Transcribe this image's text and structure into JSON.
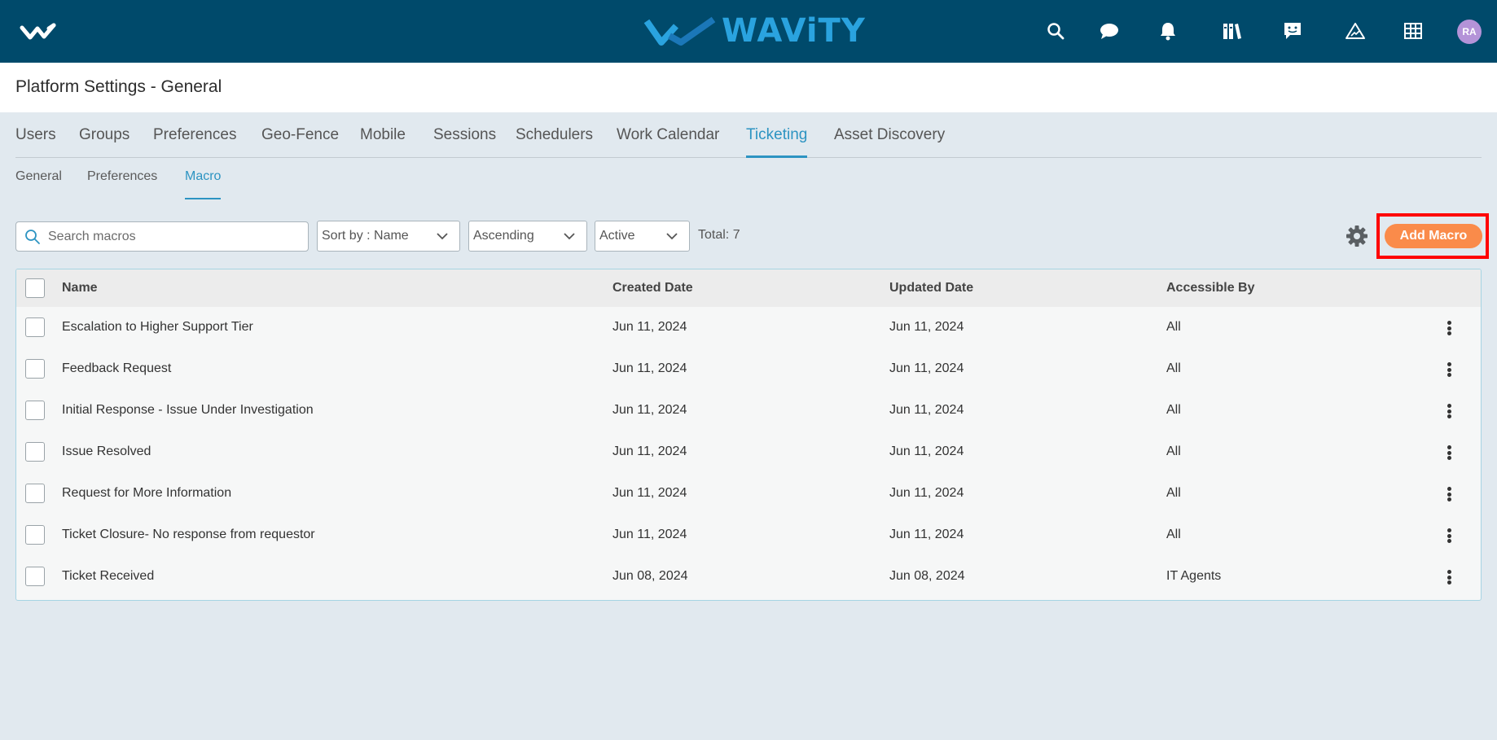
{
  "header": {
    "brand": "WAViTY",
    "avatar_initials": "RA",
    "icons": [
      "search-icon",
      "chat-icon",
      "bell-icon",
      "books-icon",
      "feedback-icon",
      "alert-icon",
      "grid-icon"
    ]
  },
  "page": {
    "title": "Platform Settings - General"
  },
  "tabs": [
    {
      "label": "Users"
    },
    {
      "label": "Groups"
    },
    {
      "label": "Preferences"
    },
    {
      "label": "Geo-Fence"
    },
    {
      "label": "Mobile"
    },
    {
      "label": "Sessions"
    },
    {
      "label": "Schedulers"
    },
    {
      "label": "Work Calendar"
    },
    {
      "label": "Ticketing"
    },
    {
      "label": "Asset Discovery"
    }
  ],
  "active_tab": "Ticketing",
  "subtabs": [
    {
      "label": "General"
    },
    {
      "label": "Preferences"
    },
    {
      "label": "Macro"
    }
  ],
  "active_subtab": "Macro",
  "toolbar": {
    "search_placeholder": "Search macros",
    "sort_by": "Sort by : Name",
    "order": "Ascending",
    "status": "Active",
    "total": "Total: 7",
    "add_label": "Add Macro"
  },
  "table": {
    "headers": {
      "name": "Name",
      "created": "Created Date",
      "updated": "Updated Date",
      "access": "Accessible By"
    },
    "rows": [
      {
        "name": "Escalation to Higher Support Tier",
        "created": "Jun 11, 2024",
        "updated": "Jun 11, 2024",
        "access": "All"
      },
      {
        "name": "Feedback Request",
        "created": "Jun 11, 2024",
        "updated": "Jun 11, 2024",
        "access": "All"
      },
      {
        "name": "Initial Response - Issue Under Investigation",
        "created": "Jun 11, 2024",
        "updated": "Jun 11, 2024",
        "access": "All"
      },
      {
        "name": "Issue Resolved",
        "created": "Jun 11, 2024",
        "updated": "Jun 11, 2024",
        "access": "All"
      },
      {
        "name": "Request for More Information",
        "created": "Jun 11, 2024",
        "updated": "Jun 11, 2024",
        "access": "All"
      },
      {
        "name": "Ticket Closure- No response from requestor",
        "created": "Jun 11, 2024",
        "updated": "Jun 11, 2024",
        "access": "All"
      },
      {
        "name": "Ticket Received",
        "created": "Jun 08, 2024",
        "updated": "Jun 08, 2024",
        "access": "IT Agents"
      }
    ]
  },
  "colors": {
    "header_bg": "#004a6b",
    "accent": "#2d94c2",
    "add_button": "#fa8b4a",
    "highlight": "#ff0000"
  }
}
